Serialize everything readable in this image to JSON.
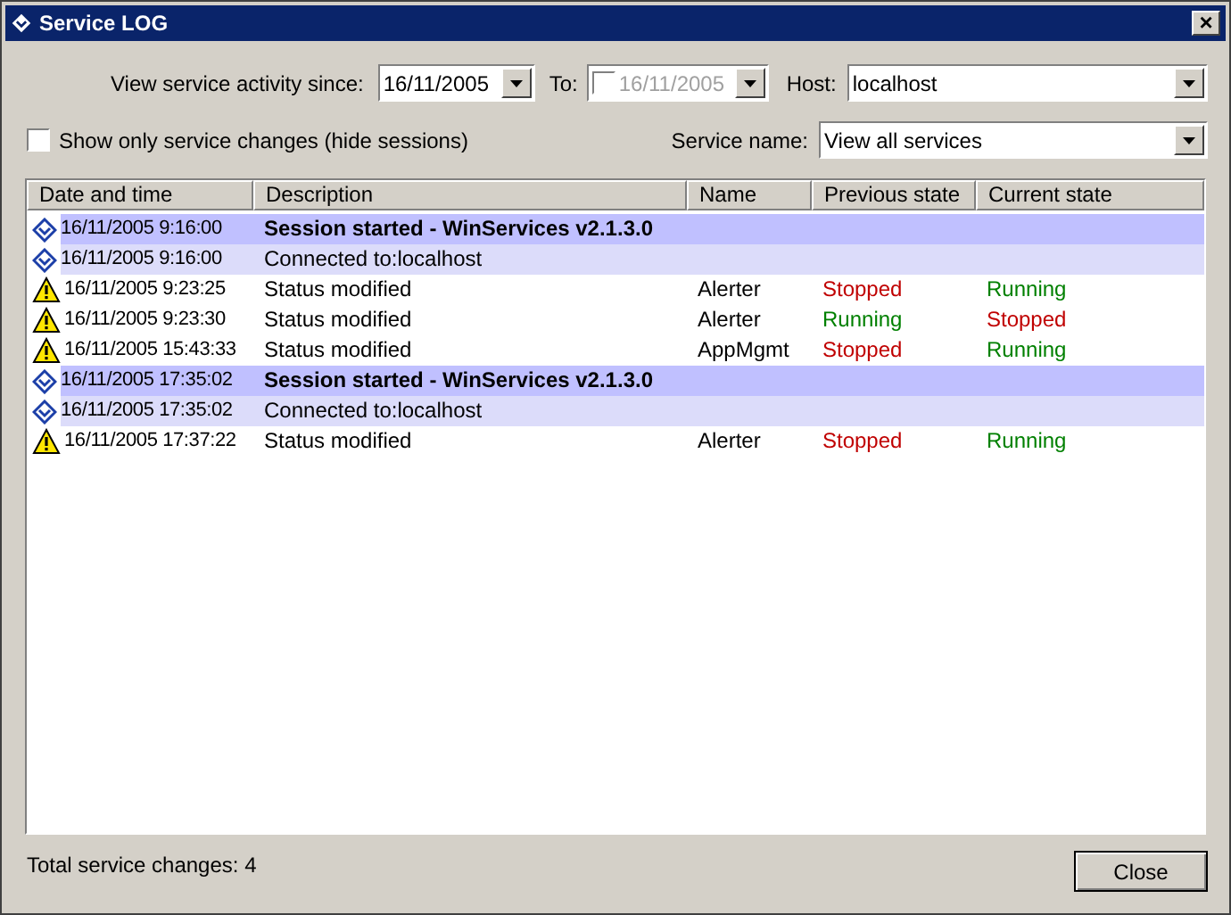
{
  "window": {
    "title": "Service LOG",
    "close": "×"
  },
  "filters": {
    "since_label": "View service activity since:",
    "since_value": "16/11/2005",
    "to_label": "To:",
    "to_checked": false,
    "to_value": "16/11/2005",
    "host_label": "Host:",
    "host_value": "localhost",
    "hide_sessions_label": "Show only service changes (hide sessions)",
    "hide_sessions_checked": false,
    "service_label": "Service name:",
    "service_value": "View all services"
  },
  "table": {
    "columns": [
      "Date and time",
      "Description",
      "Name",
      "Previous state",
      "Current state"
    ],
    "rows": [
      {
        "kind": "session",
        "time": "16/11/2005 9:16:00",
        "description": "Session started - WinServices v2.1.3.0"
      },
      {
        "kind": "connect",
        "time": "16/11/2005 9:16:00",
        "description": "Connected to:localhost"
      },
      {
        "kind": "change",
        "time": "16/11/2005 9:23:25",
        "description": "Status modified",
        "name": "Alerter",
        "previous": {
          "text": "Stopped",
          "color": "#c00000"
        },
        "current": {
          "text": "Running",
          "color": "#008000"
        }
      },
      {
        "kind": "change",
        "time": "16/11/2005 9:23:30",
        "description": "Status modified",
        "name": "Alerter",
        "previous": {
          "text": "Running",
          "color": "#008000"
        },
        "current": {
          "text": "Stopped",
          "color": "#c00000"
        }
      },
      {
        "kind": "change",
        "time": "16/11/2005 15:43:33",
        "description": "Status modified",
        "name": "AppMgmt",
        "previous": {
          "text": "Stopped",
          "color": "#c00000"
        },
        "current": {
          "text": "Running",
          "color": "#008000"
        }
      },
      {
        "kind": "session",
        "time": "16/11/2005 17:35:02",
        "description": "Session started - WinServices v2.1.3.0"
      },
      {
        "kind": "connect",
        "time": "16/11/2005 17:35:02",
        "description": "Connected to:localhost"
      },
      {
        "kind": "change",
        "time": "16/11/2005 17:37:22",
        "description": "Status modified",
        "name": "Alerter",
        "previous": {
          "text": "Stopped",
          "color": "#c00000"
        },
        "current": {
          "text": "Running",
          "color": "#008000"
        }
      }
    ]
  },
  "status": "Total service changes: 4",
  "buttons": [
    "Close"
  ]
}
